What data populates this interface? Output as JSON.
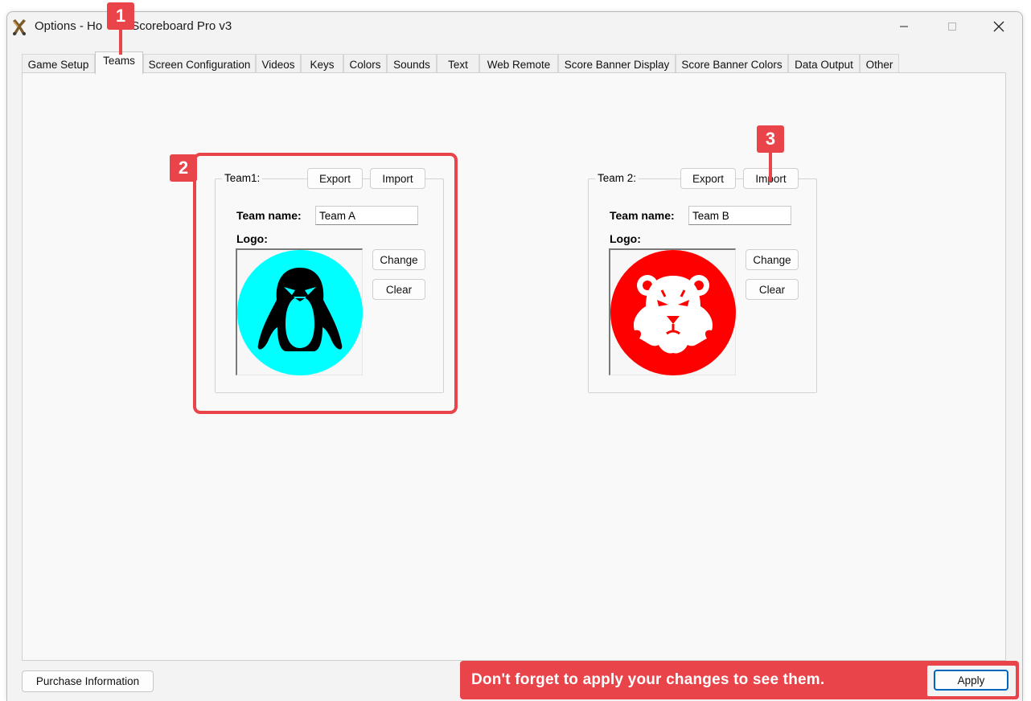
{
  "window": {
    "title": "Options - Ho",
    "title_rest": "Scoreboard Pro v3"
  },
  "tabs": [
    {
      "label": "Game Setup",
      "active": false
    },
    {
      "label": "Teams",
      "active": true
    },
    {
      "label": "Screen Configuration",
      "active": false
    },
    {
      "label": "Videos",
      "active": false
    },
    {
      "label": "Keys",
      "active": false
    },
    {
      "label": "Colors",
      "active": false
    },
    {
      "label": "Sounds",
      "active": false
    },
    {
      "label": "Text",
      "active": false
    },
    {
      "label": "Web Remote",
      "active": false
    },
    {
      "label": "Score Banner Display",
      "active": false
    },
    {
      "label": "Score Banner Colors",
      "active": false
    },
    {
      "label": "Data Output",
      "active": false
    },
    {
      "label": "Other",
      "active": false
    }
  ],
  "team1": {
    "group_label": "Team1:",
    "export_label": "Export",
    "import_label": "Import",
    "name_label": "Team name:",
    "name_value": "Team A",
    "logo_label": "Logo:",
    "change_label": "Change",
    "clear_label": "Clear",
    "logo_icon": "penguin-icon",
    "logo_color": "#00ffff"
  },
  "team2": {
    "group_label": "Team 2:",
    "export_label": "Export",
    "import_label": "Import",
    "name_label": "Team name:",
    "name_value": "Team B",
    "logo_label": "Logo:",
    "change_label": "Change",
    "clear_label": "Clear",
    "logo_icon": "bear-icon",
    "logo_color": "#ff0000"
  },
  "footer": {
    "purchase_label": "Purchase Information",
    "apply_label": "Apply"
  },
  "annotations": {
    "marker1": "1",
    "marker2": "2",
    "marker3": "3",
    "callout_text": "Don't forget to apply your changes to see them.",
    "accent_color": "#e8444a"
  }
}
